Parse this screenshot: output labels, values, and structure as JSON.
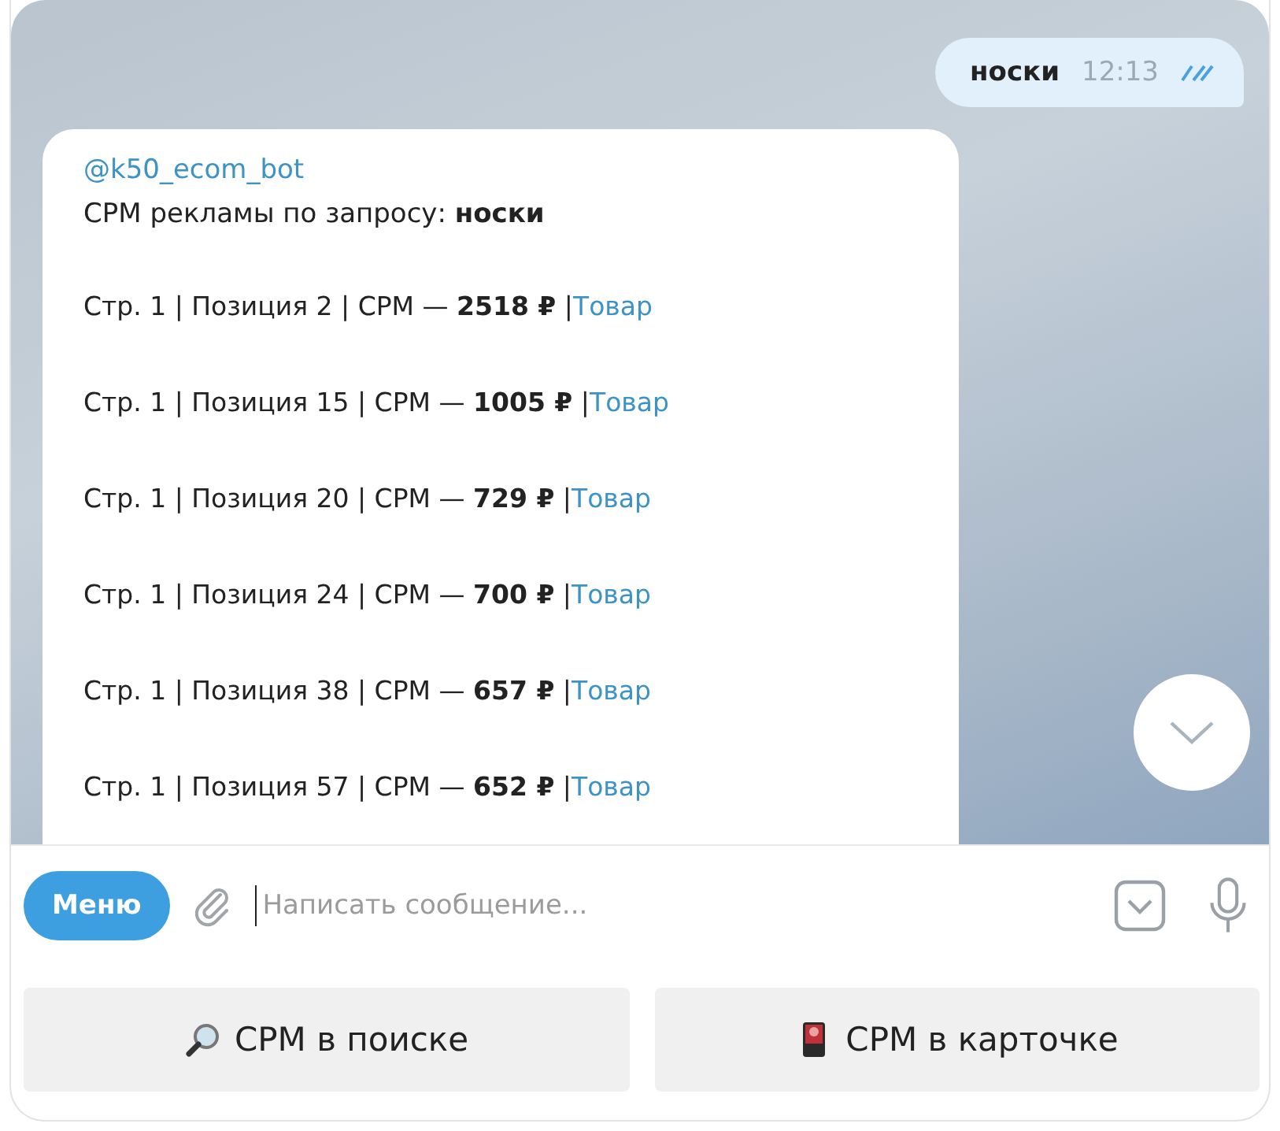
{
  "outgoing": {
    "text": "носки",
    "time": "12:13",
    "read": true
  },
  "incoming": {
    "sender": "@k50_ecom_bot",
    "title": "CPM рекламы по запросу: **носки**",
    "rows": [
      {
        "text": "Стр. 1 | Позиция 2 | CPM — **2518 ₽** |",
        "link": "Товар"
      },
      {
        "text": "Стр. 1 | Позиция 15 | CPM — **1005 ₽** |",
        "link": "Товар"
      },
      {
        "text": "Стр. 1 | Позиция 20 | CPM — **729 ₽** |",
        "link": "Товар"
      },
      {
        "text": "Стр. 1 | Позиция 24 | CPM — **700 ₽** |",
        "link": "Товар"
      },
      {
        "text": "Стр. 1 | Позиция 38 | CPM — **657 ₽** |",
        "link": "Товар"
      },
      {
        "text": "Стр. 1 | Позиция 57 | CPM — **652 ₽** |",
        "link": "Товар"
      }
    ]
  },
  "composer": {
    "menu": "Меню",
    "placeholder": "Написать сообщение..."
  },
  "keyboard": [
    {
      "kind": "search",
      "label": "CPM в поиске"
    },
    {
      "kind": "card",
      "label": "CPM в карточке"
    }
  ]
}
